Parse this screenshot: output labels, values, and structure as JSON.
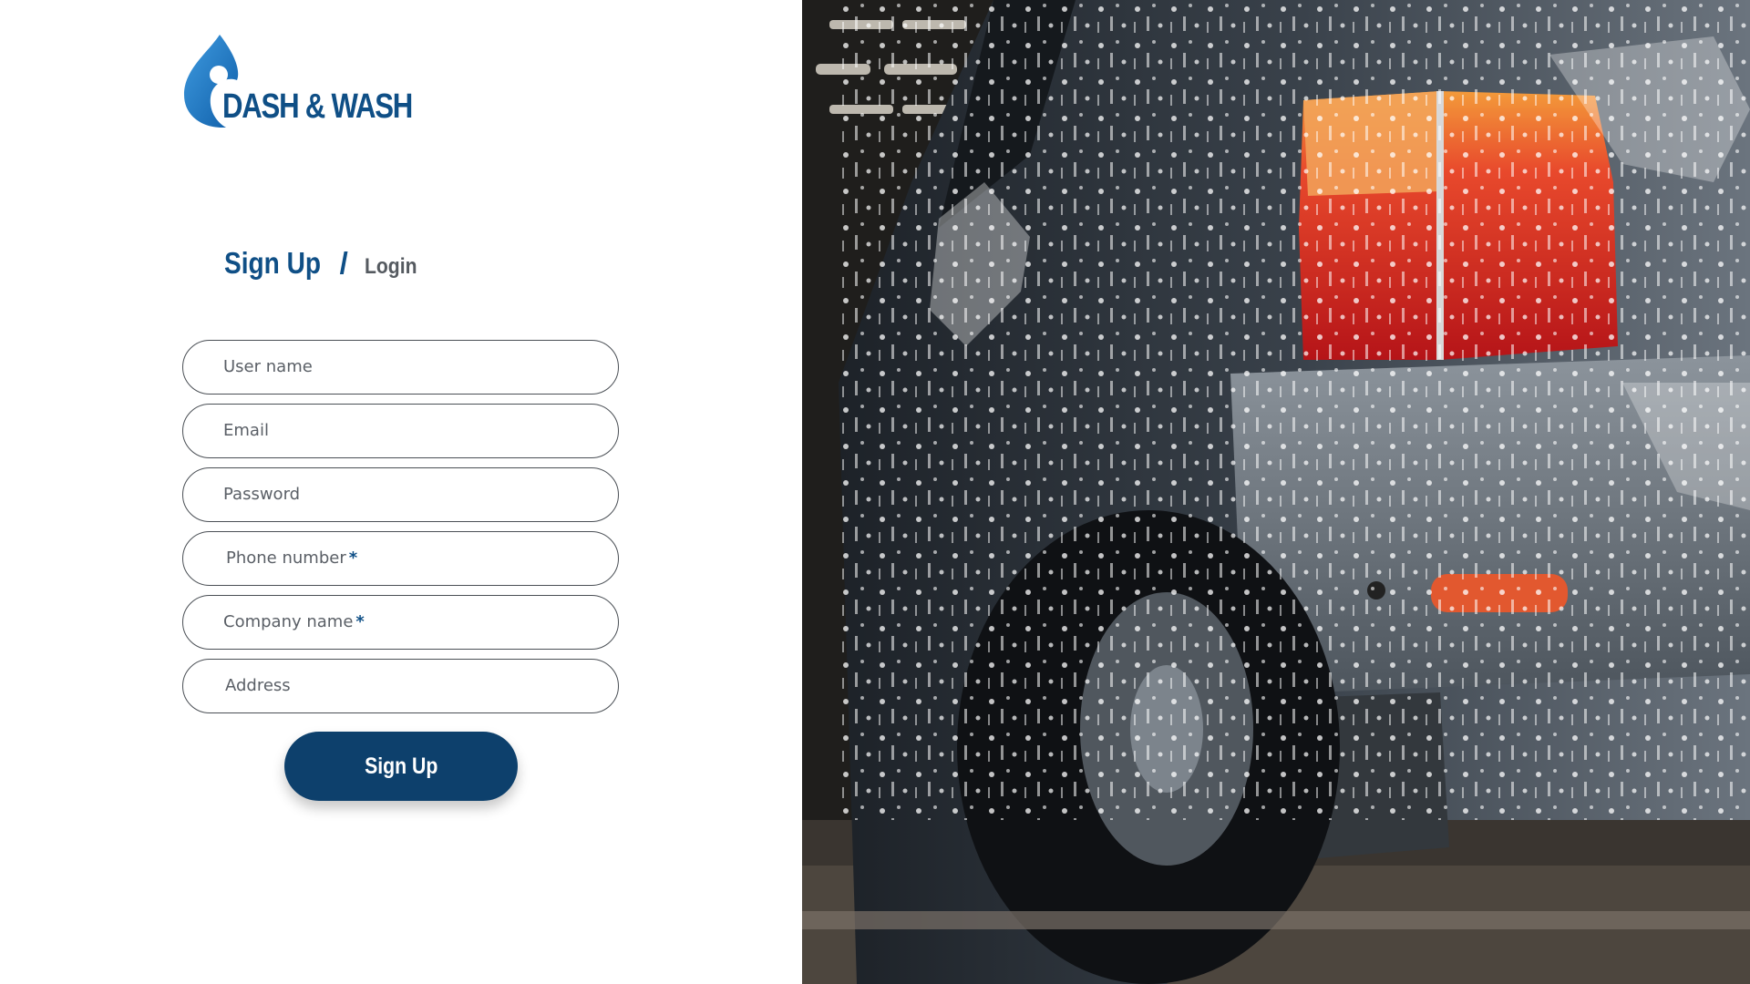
{
  "brand": {
    "name": "DASH & WASH",
    "primary_color": "#0f4f86",
    "dark_color": "#0d406c",
    "logo_icon": "water-drop-icon"
  },
  "tabs": {
    "signup_label": "Sign Up",
    "separator": "/",
    "login_label": "Login"
  },
  "form": {
    "fields": [
      {
        "label": "User name",
        "required": false
      },
      {
        "label": "Email",
        "required": false
      },
      {
        "label": "Password",
        "required": false
      },
      {
        "label": "Phone number",
        "required": true
      },
      {
        "label": "Company name",
        "required": true
      },
      {
        "label": "Address",
        "required": false
      }
    ],
    "required_marker": "*",
    "submit_label": "Sign Up"
  },
  "hero_image": {
    "alt": "car-wash-photo"
  }
}
